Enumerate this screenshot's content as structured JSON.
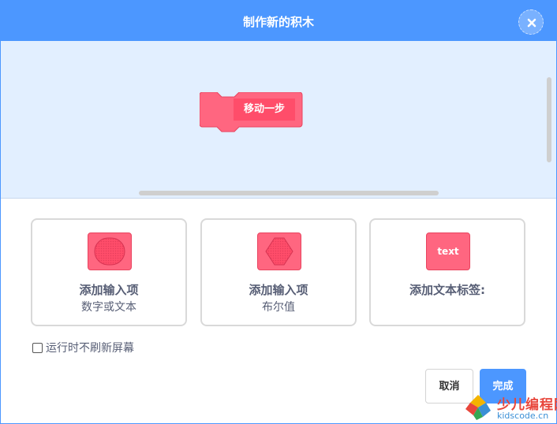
{
  "dialog": {
    "title": "制作新的积木",
    "close_icon": "close-icon"
  },
  "workspace": {
    "block_label": "移动一步",
    "block_color": "#ff6680",
    "block_input_color": "#ff4d6a",
    "background": "#e2efff"
  },
  "options": [
    {
      "icon": "number-text-input-icon",
      "title": "添加输入项",
      "subtitle": "数字或文本"
    },
    {
      "icon": "boolean-input-icon",
      "title": "添加输入项",
      "subtitle": "布尔值"
    },
    {
      "icon": "label-text-icon",
      "icon_text": "text",
      "title": "添加文本标签:"
    }
  ],
  "refresh": {
    "label": "运行时不刷新屏幕",
    "checked": false
  },
  "buttons": {
    "cancel": "取消",
    "ok": "完成"
  },
  "watermark": {
    "name": "少儿编程网",
    "url": "kidscode.cn"
  },
  "colors": {
    "accent": "#4c97ff",
    "text": "#575e75"
  }
}
